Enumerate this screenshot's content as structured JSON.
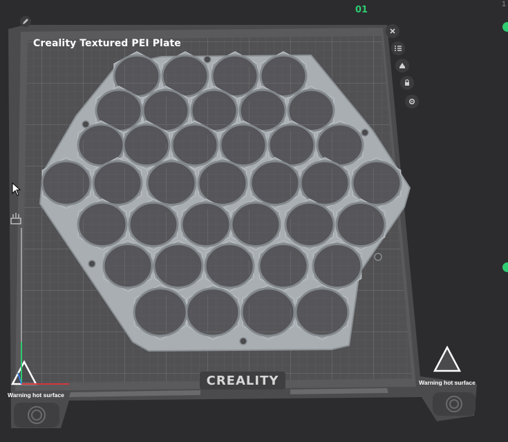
{
  "plate": {
    "number": "01",
    "name": "Creality Textured PEI Plate",
    "brand": "CREALITY",
    "warning_left": "Warning hot surface",
    "warning_right": "Warning hot surface"
  },
  "edge_number": "1",
  "plate_buttons": [
    {
      "name": "close-plate-button",
      "icon": "close-icon"
    },
    {
      "name": "arrange-button",
      "icon": "arrange-icon"
    },
    {
      "name": "orient-button",
      "icon": "orient-icon"
    },
    {
      "name": "lock-plate-button",
      "icon": "lock-icon"
    },
    {
      "name": "plate-settings-button",
      "icon": "gear-icon"
    }
  ],
  "colors": {
    "background": "#2c2c2e",
    "bed": "#515153",
    "grid": "#6d6d70",
    "model": "#a9aeb3",
    "accent": "#2ecc71"
  }
}
